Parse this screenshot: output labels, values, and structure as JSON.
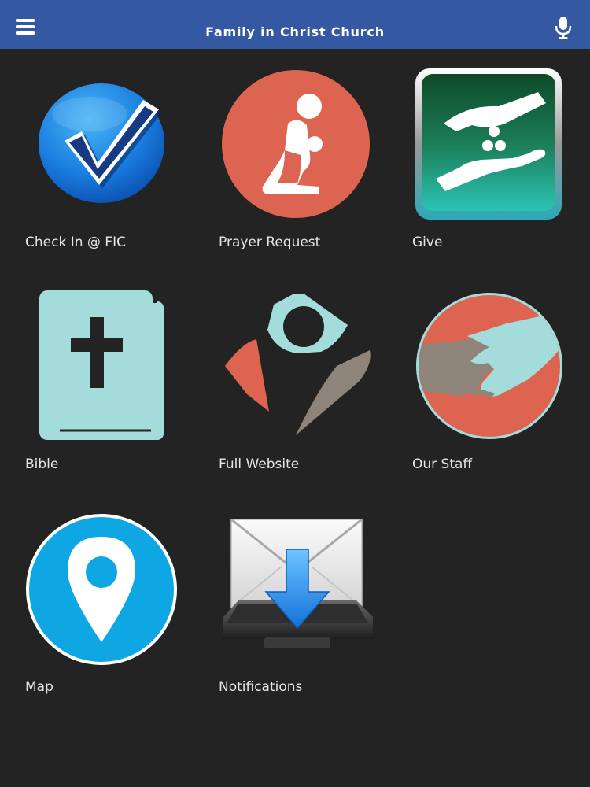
{
  "app": {
    "title": "Family in Christ Church",
    "menu_icon": "hamburger-menu-icon",
    "mic_icon": "microphone-icon"
  },
  "colors": {
    "header": "#3558a2",
    "background": "#232323",
    "label": "#e6e6e6",
    "coral": "#dc6450",
    "light_blue": "#a4dcdc",
    "taupe": "#8f847a",
    "bright_blue": "#0ea7e4"
  },
  "tiles": [
    {
      "label": "Check In @ FIC",
      "icon": "checkmark-icon"
    },
    {
      "label": "Prayer Request",
      "icon": "kneeling-prayer-icon"
    },
    {
      "label": "Give",
      "icon": "giving-hands-icon"
    },
    {
      "label": "Bible",
      "icon": "bible-icon"
    },
    {
      "label": "Full Website",
      "icon": "church-logo-icon"
    },
    {
      "label": "Our Staff",
      "icon": "handshake-icon"
    },
    {
      "label": "Map",
      "icon": "map-pin-icon"
    },
    {
      "label": "Notifications",
      "icon": "mail-inbox-icon"
    }
  ]
}
